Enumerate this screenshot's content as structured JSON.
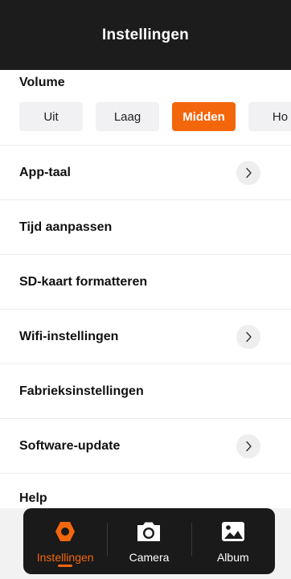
{
  "header": {
    "title": "Instellingen"
  },
  "volume": {
    "label": "Volume",
    "options": [
      "Uit",
      "Laag",
      "Midden",
      "Ho"
    ],
    "selected": "Midden"
  },
  "settings": [
    {
      "label": "App-taal",
      "chevron": true
    },
    {
      "label": "Tijd aanpassen",
      "chevron": false
    },
    {
      "label": "SD-kaart formatteren",
      "chevron": false
    },
    {
      "label": "Wifi-instellingen",
      "chevron": true
    },
    {
      "label": "Fabrieksinstellingen",
      "chevron": false
    },
    {
      "label": "Software-update",
      "chevron": true
    }
  ],
  "help": {
    "label": "Help"
  },
  "tabbar": {
    "items": [
      {
        "label": "Instellingen",
        "icon": "hexagon-settings-icon",
        "active": true
      },
      {
        "label": "Camera",
        "icon": "camera-icon",
        "active": false
      },
      {
        "label": "Album",
        "icon": "image-icon",
        "active": false
      }
    ]
  },
  "colors": {
    "accent": "#f4660c",
    "header_bg": "#1c1c1c",
    "tabbar_bg": "#1a1a1a",
    "chip_bg": "#f1f1f3",
    "chevron_bg": "#eeeeee"
  }
}
